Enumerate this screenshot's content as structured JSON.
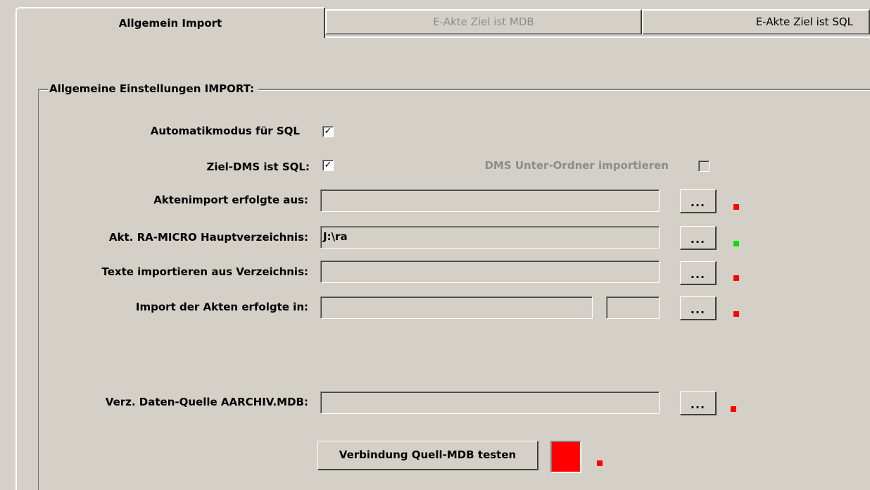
{
  "tabs": [
    {
      "label": "Allgemein Import",
      "active": true
    },
    {
      "label": "E-Akte Ziel ist MDB",
      "active": false,
      "disabled": true
    },
    {
      "label": "E-Akte Ziel ist SQL",
      "active": false
    }
  ],
  "group": {
    "title": "Allgemeine Einstellungen IMPORT:"
  },
  "checkboxes": {
    "automatik": {
      "label": "Automatikmodus für SQL",
      "checked": true,
      "mark": "✓"
    },
    "ziel_dms": {
      "label": "Ziel-DMS ist SQL:",
      "checked": true,
      "mark": "✓"
    },
    "dms_unterordner": {
      "label": "DMS Unter-Ordner importieren",
      "checked": false,
      "disabled": true,
      "mark": ""
    }
  },
  "fields": {
    "aktenimport": {
      "label": "Aktenimport erfolgte aus:",
      "value": "",
      "status_color": "#ff0000"
    },
    "hauptverzeichnis": {
      "label": "Akt. RA-MICRO Hauptverzeichnis:",
      "value": "J:\\ra",
      "status_color": "#00e000"
    },
    "texte": {
      "label": "Texte importieren aus Verzeichnis:",
      "value": "",
      "status_color": "#ff0000"
    },
    "import_akten": {
      "label": "Import der Akten erfolgte in:",
      "value": "",
      "value2": "",
      "status_color": "#ff0000"
    },
    "aarchiv": {
      "label": "Verz. Daten-Quelle AARCHIV.MDB:",
      "value": "",
      "status_color": "#ff0000"
    }
  },
  "browse_label": "...",
  "test_button": {
    "label": "Verbindung Quell-MDB testen",
    "indicator_color": "#ff0000",
    "status_color": "#ff0000"
  }
}
